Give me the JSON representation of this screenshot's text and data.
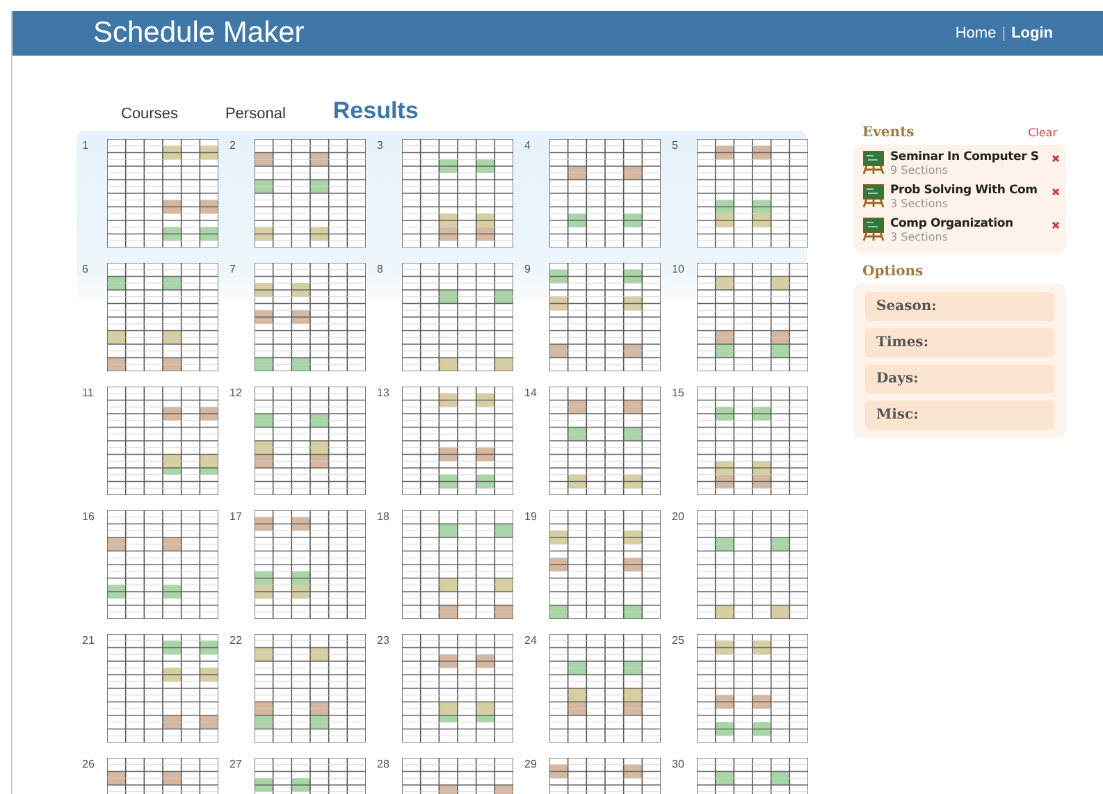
{
  "header": {
    "title": "Schedule Maker",
    "links": [
      {
        "label": "Home",
        "bold": false
      },
      {
        "label": "Login",
        "bold": true
      }
    ],
    "separator": "|"
  },
  "tabs": [
    {
      "label": "Courses",
      "selected": false
    },
    {
      "label": "Personal",
      "selected": false
    },
    {
      "label": "Results",
      "selected": true
    }
  ],
  "results": [
    {
      "number": "1"
    },
    {
      "number": "2"
    },
    {
      "number": "3"
    },
    {
      "number": "4"
    },
    {
      "number": "5"
    },
    {
      "number": "6"
    },
    {
      "number": "7"
    },
    {
      "number": "8"
    },
    {
      "number": "9"
    },
    {
      "number": "10"
    },
    {
      "number": "11"
    },
    {
      "number": "12"
    },
    {
      "number": "13"
    },
    {
      "number": "14"
    },
    {
      "number": "15"
    },
    {
      "number": "16"
    },
    {
      "number": "17"
    },
    {
      "number": "18"
    },
    {
      "number": "19"
    },
    {
      "number": "20"
    },
    {
      "number": "21"
    },
    {
      "number": "22"
    },
    {
      "number": "23"
    },
    {
      "number": "24"
    },
    {
      "number": "25"
    },
    {
      "number": "26"
    },
    {
      "number": "27"
    },
    {
      "number": "28"
    },
    {
      "number": "29"
    },
    {
      "number": "30"
    }
  ],
  "events": {
    "title": "Events",
    "clear": "Clear",
    "items": [
      {
        "title": "Seminar In Computer S",
        "sections": "9 Sections"
      },
      {
        "title": "Prob Solving With Com",
        "sections": "3 Sections"
      },
      {
        "title": "Comp Organization",
        "sections": "3 Sections"
      }
    ]
  },
  "options": {
    "title": "Options",
    "items": [
      "Season:",
      "Times:",
      "Days:",
      "Misc:"
    ]
  }
}
